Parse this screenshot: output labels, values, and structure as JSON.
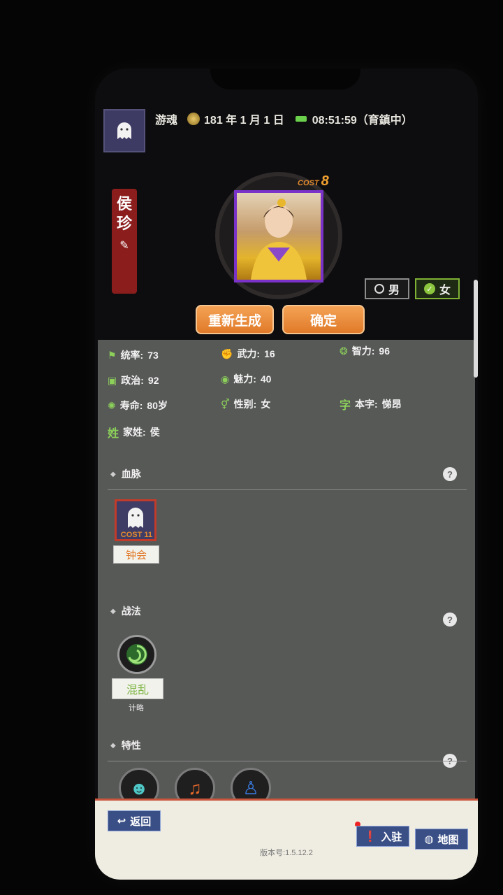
{
  "header": {
    "player_name": "游魂",
    "date": "181 年 1 月 1 日",
    "time": "08:51:59（育鎮中）"
  },
  "character": {
    "name_chars": [
      "侯",
      "珍"
    ],
    "cost_label": "COST",
    "cost_value": "8",
    "gender_male": "男",
    "gender_female": "女",
    "gender_selected": "female"
  },
  "buttons": {
    "regenerate": "重新生成",
    "confirm": "确定"
  },
  "stats": [
    {
      "label": "统率:",
      "value": "73",
      "icon": "flag-icon"
    },
    {
      "label": "武力:",
      "value": "16",
      "icon": "fist-icon"
    },
    {
      "label": "智力:",
      "value": "96",
      "icon": "brain-icon"
    },
    {
      "label": "政治:",
      "value": "92",
      "icon": "document-icon"
    },
    {
      "label": "魅力:",
      "value": "40",
      "icon": "eye-icon"
    },
    {
      "label": "寿命:",
      "value": "80岁",
      "icon": "longevity-icon"
    },
    {
      "label": "性别:",
      "value": "女",
      "icon": "gender-icon"
    },
    {
      "label": "本字:",
      "value": "悌昂",
      "icon_text": "字"
    },
    {
      "label": "家姓:",
      "value": "侯",
      "icon_text": "姓"
    }
  ],
  "sections": {
    "bloodline": "血脉",
    "tactics": "战法",
    "traits": "特性"
  },
  "bloodline_card": {
    "cost": "COST 11",
    "name": "钟会"
  },
  "tactic": {
    "name": "混乱",
    "type": "计略"
  },
  "bottom": {
    "back": "返回",
    "settle": "入驻",
    "map": "地图",
    "version": "版本号:1.5.12.2"
  }
}
